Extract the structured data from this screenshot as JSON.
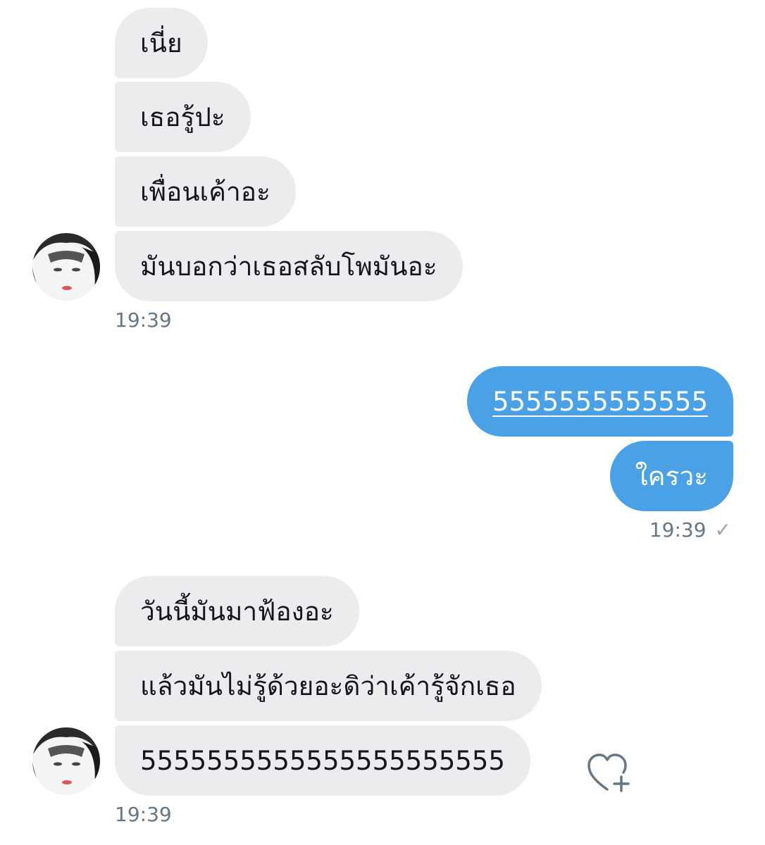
{
  "conversation": {
    "group1": {
      "messages": [
        "เนี่ย",
        "เธอรู้ปะ",
        "เพื่อนเค้าอะ",
        "มันบอกว่าเธอสลับโพมันอะ"
      ],
      "time": "19:39"
    },
    "group2": {
      "messages": [
        "5555555555555",
        "ใครวะ"
      ],
      "time": "19:39",
      "read_check": "✓"
    },
    "group3": {
      "messages": [
        "วันนี้มันมาฟ้องอะ",
        "แล้วมันไม่รู้ด้วยอะดิว่าเค้ารู้จักเธอ",
        "5555555555555555555555"
      ],
      "time": "19:39"
    }
  },
  "colors": {
    "incoming_bubble": "#ebecee",
    "outgoing_bubble": "#4aa1e6",
    "timestamp": "#657786"
  },
  "icons": {
    "avatar": "avatar",
    "like": "heart-plus-icon",
    "read": "check-icon"
  }
}
